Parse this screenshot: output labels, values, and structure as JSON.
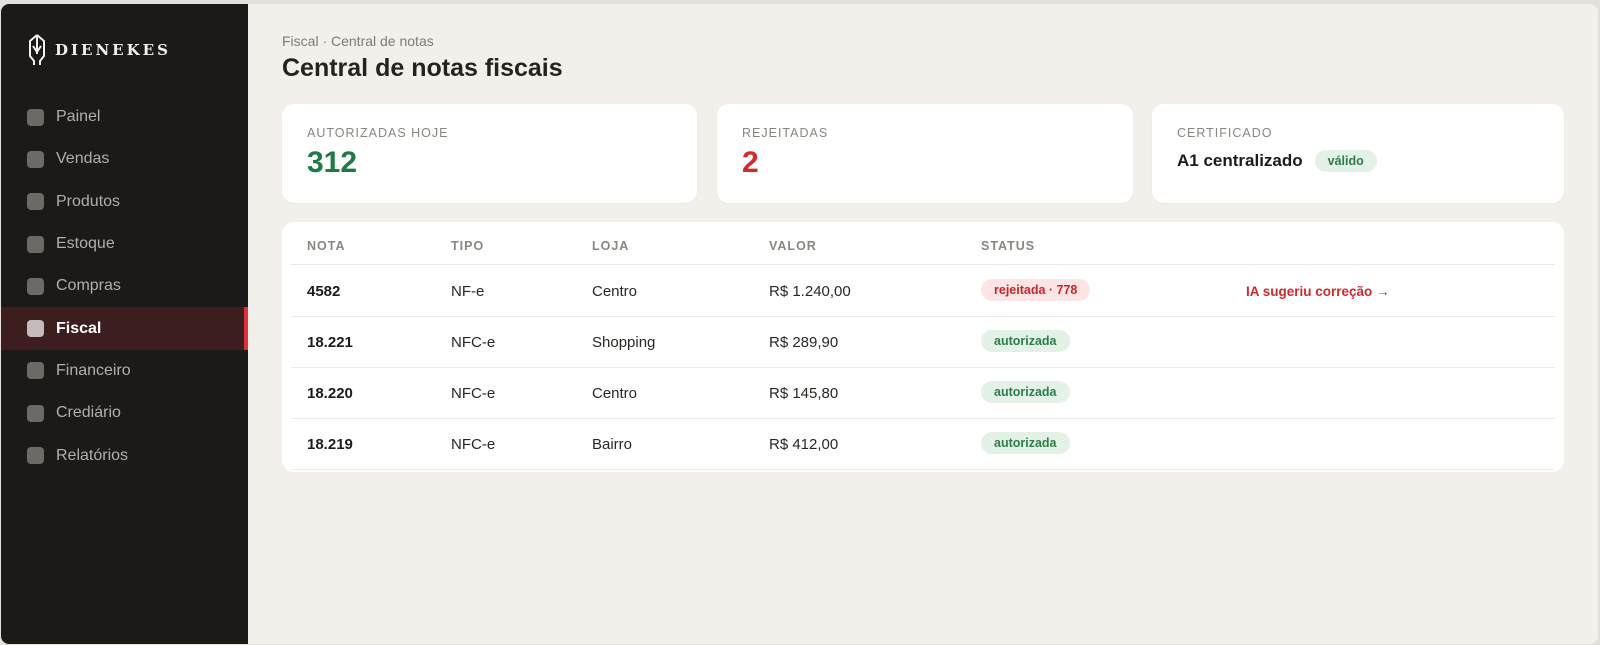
{
  "brand": {
    "name": "DIENEKES",
    "logo_icon": "spartan-helmet-icon"
  },
  "sidebar": {
    "items": [
      {
        "label": "Painel",
        "active": false
      },
      {
        "label": "Vendas",
        "active": false
      },
      {
        "label": "Produtos",
        "active": false
      },
      {
        "label": "Estoque",
        "active": false
      },
      {
        "label": "Compras",
        "active": false
      },
      {
        "label": "Fiscal",
        "active": true
      },
      {
        "label": "Financeiro",
        "active": false
      },
      {
        "label": "Crediário",
        "active": false
      },
      {
        "label": "Relatórios",
        "active": false
      }
    ]
  },
  "header": {
    "breadcrumb": "Fiscal · Central de notas",
    "title": "Central de notas fiscais"
  },
  "cards": {
    "authorized": {
      "label": "AUTORIZADAS HOJE",
      "value": "312"
    },
    "rejected": {
      "label": "REJEITADAS",
      "value": "2"
    },
    "certificate": {
      "label": "CERTIFICADO",
      "value": "A1 centralizado",
      "badge": "válido"
    }
  },
  "table": {
    "columns": [
      "NOTA",
      "TIPO",
      "LOJA",
      "VALOR",
      "STATUS"
    ],
    "rows": [
      {
        "nota": "4582",
        "tipo": "NF-e",
        "loja": "Centro",
        "valor": "R$ 1.240,00",
        "status": "rejeitada · 778",
        "status_kind": "bad",
        "action": "IA sugeriu correção →"
      },
      {
        "nota": "18.221",
        "tipo": "NFC-e",
        "loja": "Shopping",
        "valor": "R$ 289,90",
        "status": "autorizada",
        "status_kind": "ok",
        "action": ""
      },
      {
        "nota": "18.220",
        "tipo": "NFC-e",
        "loja": "Centro",
        "valor": "R$ 145,80",
        "status": "autorizada",
        "status_kind": "ok",
        "action": ""
      },
      {
        "nota": "18.219",
        "tipo": "NFC-e",
        "loja": "Bairro",
        "valor": "R$ 412,00",
        "status": "autorizada",
        "status_kind": "ok",
        "action": ""
      }
    ]
  },
  "colors": {
    "sidebar_bg": "#1c1a18",
    "accent_red": "#e02f36",
    "success_green": "#217a45",
    "error_red": "#d42a2f",
    "page_bg": "#f3f0eb"
  }
}
